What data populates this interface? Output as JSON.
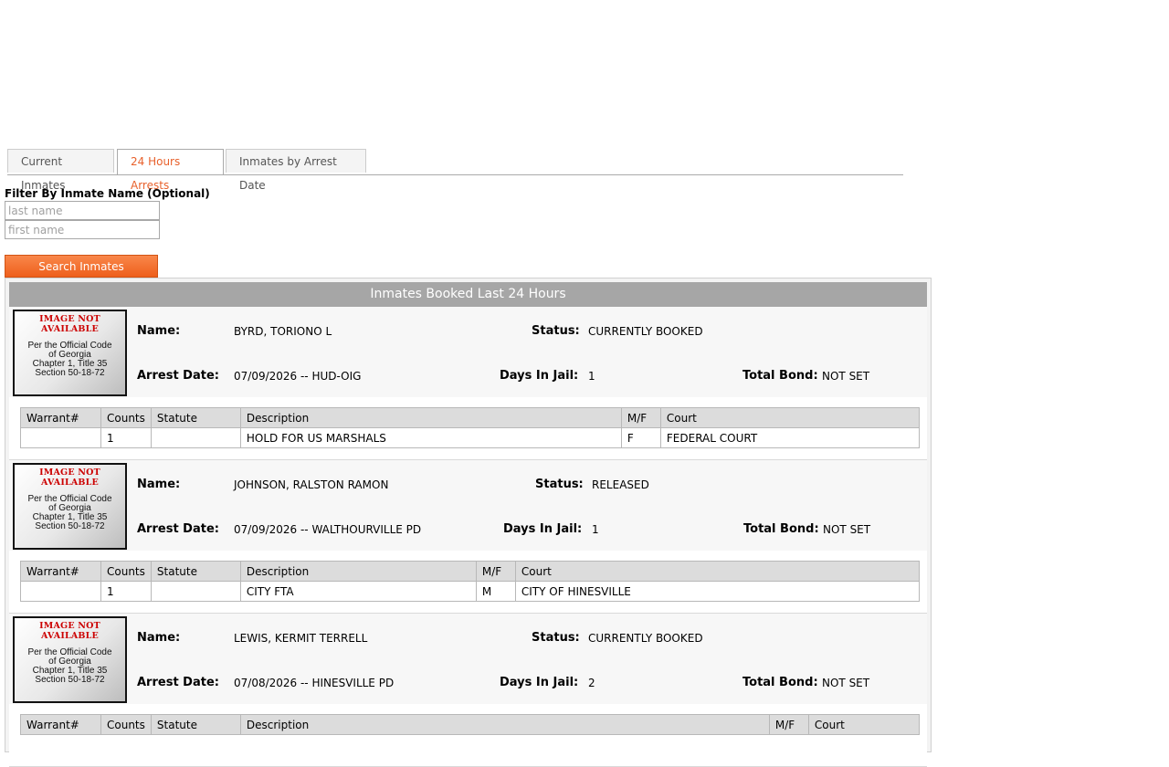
{
  "tabs": [
    {
      "label": "Current Inmates",
      "active": false
    },
    {
      "label": "24 Hours Arrests",
      "active": true
    },
    {
      "label": "Inmates by Arrest Date",
      "active": false
    }
  ],
  "filter": {
    "label": "Filter By Inmate Name (Optional)",
    "last_name_placeholder": "last name",
    "first_name_placeholder": "first name",
    "last_name_value": "",
    "first_name_value": "",
    "search_label": "Search Inmates"
  },
  "panel": {
    "title": "Inmates Booked Last 24 Hours"
  },
  "photo": {
    "not_available": "IMAGE NOT AVAILABLE",
    "code_lines": [
      "Per the Official Code",
      "of Georgia",
      "Chapter 1, Title 35",
      "Section 50-18-72"
    ]
  },
  "labels": {
    "name": "Name:",
    "status": "Status:",
    "arrest_date": "Arrest Date:",
    "days_in_jail": "Days In Jail:",
    "total_bond": "Total Bond:"
  },
  "warrant_headers": [
    "Warrant#",
    "Counts",
    "Statute",
    "Description",
    "M/F",
    "Court"
  ],
  "inmates": [
    {
      "name": "BYRD, TORIONO L",
      "status": "CURRENTLY BOOKED",
      "arrest": "07/09/2026 -- HUD-OIG",
      "days": "1",
      "bond": "NOT SET",
      "warrants": [
        {
          "warrant": "",
          "counts": "1",
          "statute": "",
          "description": "HOLD FOR US MARSHALS",
          "mf": "F",
          "court": "FEDERAL COURT"
        }
      ]
    },
    {
      "name": "JOHNSON, RALSTON RAMON",
      "status": "RELEASED",
      "arrest": "07/09/2026 -- WALTHOURVILLE PD",
      "days": "1",
      "bond": "NOT SET",
      "warrants": [
        {
          "warrant": "",
          "counts": "1",
          "statute": "",
          "description": "CITY FTA",
          "mf": "M",
          "court": "CITY OF HINESVILLE"
        }
      ]
    },
    {
      "name": "LEWIS, KERMIT TERRELL",
      "status": "CURRENTLY BOOKED",
      "arrest": "07/08/2026 -- HINESVILLE PD",
      "days": "2",
      "bond": "NOT SET",
      "warrants": []
    }
  ]
}
